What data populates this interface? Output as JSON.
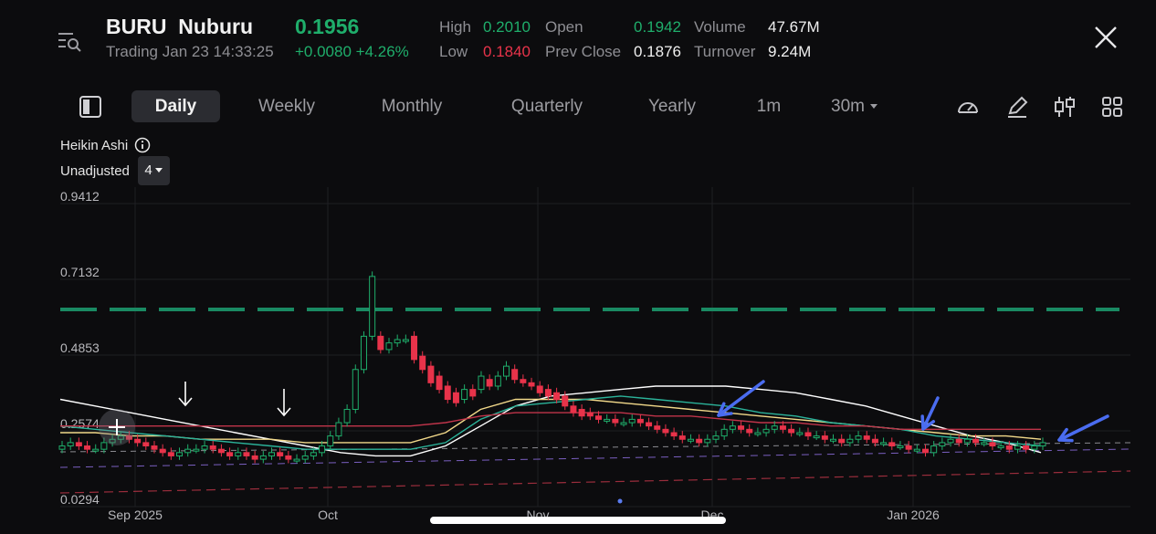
{
  "header": {
    "symbol": "BURU",
    "name": "Nuburu",
    "last_price": "0.1956",
    "trading_time": "Trading Jan 23 14:33:25",
    "change": "+0.0080 +4.26%",
    "stats": {
      "high_label": "High",
      "high": "0.2010",
      "low_label": "Low",
      "low": "0.1840",
      "open_label": "Open",
      "open": "0.1942",
      "prev_close_label": "Prev Close",
      "prev_close": "0.1876",
      "volume_label": "Volume",
      "volume": "47.67M",
      "turnover_label": "Turnover",
      "turnover": "9.24M"
    }
  },
  "tabs": {
    "daily": "Daily",
    "weekly": "Weekly",
    "monthly": "Monthly",
    "quarterly": "Quarterly",
    "yearly": "Yearly",
    "m1": "1m",
    "m30": "30m"
  },
  "chart_options": {
    "type_label": "Heikin Ashi",
    "adjust_label": "Unadjusted",
    "indicator_count": "4"
  },
  "icons": [
    "menu-search-icon",
    "close-icon",
    "panel-toggle-icon",
    "chevron-down-icon",
    "gauge-icon",
    "pencil-icon",
    "candlestick-icon",
    "grid-icon",
    "info-icon"
  ],
  "colors": {
    "up": "#1fae6b",
    "down": "#e8334a",
    "accent_line": "#1a8a63",
    "annotation_arrow": "#4a6cf0"
  },
  "chart_data": {
    "type": "candlestick",
    "y_ticks": [
      "0.9412",
      "0.7132",
      "0.4853",
      "0.2574",
      "0.0294"
    ],
    "x_ticks": [
      "Sep 2025",
      "Oct",
      "Nov",
      "Dec",
      "Jan 2026"
    ],
    "ylim": [
      0.0294,
      0.9412
    ],
    "reference_line": 0.62,
    "grid": true,
    "candles": [
      {
        "o": 0.18,
        "c": 0.19
      },
      {
        "o": 0.19,
        "c": 0.2
      },
      {
        "o": 0.2,
        "c": 0.19
      },
      {
        "o": 0.19,
        "c": 0.18
      },
      {
        "o": 0.18,
        "c": 0.18
      },
      {
        "o": 0.18,
        "c": 0.2
      },
      {
        "o": 0.2,
        "c": 0.21
      },
      {
        "o": 0.21,
        "c": 0.22
      },
      {
        "o": 0.22,
        "c": 0.21
      },
      {
        "o": 0.21,
        "c": 0.2
      },
      {
        "o": 0.2,
        "c": 0.19
      },
      {
        "o": 0.19,
        "c": 0.18
      },
      {
        "o": 0.18,
        "c": 0.17
      },
      {
        "o": 0.17,
        "c": 0.16
      },
      {
        "o": 0.16,
        "c": 0.17
      },
      {
        "o": 0.17,
        "c": 0.18
      },
      {
        "o": 0.18,
        "c": 0.18
      },
      {
        "o": 0.18,
        "c": 0.19
      },
      {
        "o": 0.19,
        "c": 0.18
      },
      {
        "o": 0.18,
        "c": 0.17
      },
      {
        "o": 0.17,
        "c": 0.16
      },
      {
        "o": 0.16,
        "c": 0.17
      },
      {
        "o": 0.17,
        "c": 0.16
      },
      {
        "o": 0.16,
        "c": 0.15
      },
      {
        "o": 0.15,
        "c": 0.16
      },
      {
        "o": 0.16,
        "c": 0.17
      },
      {
        "o": 0.17,
        "c": 0.16
      },
      {
        "o": 0.16,
        "c": 0.15
      },
      {
        "o": 0.15,
        "c": 0.15
      },
      {
        "o": 0.15,
        "c": 0.16
      },
      {
        "o": 0.16,
        "c": 0.17
      },
      {
        "o": 0.17,
        "c": 0.19
      },
      {
        "o": 0.19,
        "c": 0.22
      },
      {
        "o": 0.22,
        "c": 0.26
      },
      {
        "o": 0.26,
        "c": 0.3
      },
      {
        "o": 0.3,
        "c": 0.42
      },
      {
        "o": 0.42,
        "c": 0.52
      },
      {
        "o": 0.52,
        "c": 0.7
      },
      {
        "o": 0.52,
        "c": 0.48
      },
      {
        "o": 0.48,
        "c": 0.5
      },
      {
        "o": 0.5,
        "c": 0.51
      },
      {
        "o": 0.51,
        "c": 0.51
      },
      {
        "o": 0.52,
        "c": 0.45
      },
      {
        "o": 0.46,
        "c": 0.42
      },
      {
        "o": 0.43,
        "c": 0.38
      },
      {
        "o": 0.4,
        "c": 0.36
      },
      {
        "o": 0.37,
        "c": 0.33
      },
      {
        "o": 0.35,
        "c": 0.32
      },
      {
        "o": 0.33,
        "c": 0.36
      },
      {
        "o": 0.36,
        "c": 0.34
      },
      {
        "o": 0.36,
        "c": 0.4
      },
      {
        "o": 0.39,
        "c": 0.37
      },
      {
        "o": 0.37,
        "c": 0.4
      },
      {
        "o": 0.4,
        "c": 0.43
      },
      {
        "o": 0.42,
        "c": 0.39
      },
      {
        "o": 0.39,
        "c": 0.38
      },
      {
        "o": 0.38,
        "c": 0.37
      },
      {
        "o": 0.37,
        "c": 0.35
      },
      {
        "o": 0.36,
        "c": 0.34
      },
      {
        "o": 0.35,
        "c": 0.33
      },
      {
        "o": 0.34,
        "c": 0.31
      },
      {
        "o": 0.31,
        "c": 0.29
      },
      {
        "o": 0.3,
        "c": 0.28
      },
      {
        "o": 0.29,
        "c": 0.28
      },
      {
        "o": 0.28,
        "c": 0.27
      },
      {
        "o": 0.27,
        "c": 0.27
      },
      {
        "o": 0.27,
        "c": 0.26
      },
      {
        "o": 0.26,
        "c": 0.26
      },
      {
        "o": 0.26,
        "c": 0.27
      },
      {
        "o": 0.27,
        "c": 0.26
      },
      {
        "o": 0.26,
        "c": 0.25
      },
      {
        "o": 0.25,
        "c": 0.24
      },
      {
        "o": 0.24,
        "c": 0.23
      },
      {
        "o": 0.23,
        "c": 0.22
      },
      {
        "o": 0.22,
        "c": 0.21
      },
      {
        "o": 0.21,
        "c": 0.21
      },
      {
        "o": 0.21,
        "c": 0.2
      },
      {
        "o": 0.2,
        "c": 0.21
      },
      {
        "o": 0.21,
        "c": 0.22
      },
      {
        "o": 0.22,
        "c": 0.24
      },
      {
        "o": 0.24,
        "c": 0.25
      },
      {
        "o": 0.25,
        "c": 0.24
      },
      {
        "o": 0.24,
        "c": 0.23
      },
      {
        "o": 0.23,
        "c": 0.23
      },
      {
        "o": 0.23,
        "c": 0.24
      },
      {
        "o": 0.24,
        "c": 0.25
      },
      {
        "o": 0.25,
        "c": 0.24
      },
      {
        "o": 0.24,
        "c": 0.23
      },
      {
        "o": 0.23,
        "c": 0.23
      },
      {
        "o": 0.23,
        "c": 0.22
      },
      {
        "o": 0.22,
        "c": 0.22
      },
      {
        "o": 0.22,
        "c": 0.21
      },
      {
        "o": 0.21,
        "c": 0.21
      },
      {
        "o": 0.21,
        "c": 0.2
      },
      {
        "o": 0.2,
        "c": 0.21
      },
      {
        "o": 0.21,
        "c": 0.22
      },
      {
        "o": 0.22,
        "c": 0.21
      },
      {
        "o": 0.21,
        "c": 0.2
      },
      {
        "o": 0.2,
        "c": 0.2
      },
      {
        "o": 0.2,
        "c": 0.19
      },
      {
        "o": 0.19,
        "c": 0.19
      },
      {
        "o": 0.19,
        "c": 0.18
      },
      {
        "o": 0.18,
        "c": 0.18
      },
      {
        "o": 0.18,
        "c": 0.17
      },
      {
        "o": 0.17,
        "c": 0.19
      },
      {
        "o": 0.19,
        "c": 0.2
      },
      {
        "o": 0.2,
        "c": 0.21
      },
      {
        "o": 0.21,
        "c": 0.2
      },
      {
        "o": 0.2,
        "c": 0.21
      },
      {
        "o": 0.21,
        "c": 0.2
      },
      {
        "o": 0.2,
        "c": 0.2
      },
      {
        "o": 0.2,
        "c": 0.19
      },
      {
        "o": 0.19,
        "c": 0.19
      },
      {
        "o": 0.19,
        "c": 0.18
      },
      {
        "o": 0.18,
        "c": 0.19
      },
      {
        "o": 0.19,
        "c": 0.18
      },
      {
        "o": 0.18,
        "c": 0.19
      },
      {
        "o": 0.19,
        "c": 0.2
      }
    ],
    "moving_averages": [
      {
        "name": "",
        "color": "#ffffff",
        "values": [
          0.33,
          0.31,
          0.29,
          0.27,
          0.25,
          0.23,
          0.21,
          0.19,
          0.17,
          0.16,
          0.16,
          0.19,
          0.25,
          0.31,
          0.34,
          0.35,
          0.36,
          0.37,
          0.37,
          0.37,
          0.36,
          0.35,
          0.33,
          0.31,
          0.28,
          0.25,
          0.22,
          0.2,
          0.17
        ]
      },
      {
        "name": "",
        "color": "#f2d98a",
        "values": [
          0.23,
          0.23,
          0.22,
          0.22,
          0.21,
          0.21,
          0.21,
          0.2,
          0.2,
          0.2,
          0.2,
          0.23,
          0.3,
          0.33,
          0.33,
          0.33,
          0.32,
          0.31,
          0.3,
          0.29,
          0.28,
          0.27,
          0.26,
          0.25,
          0.24,
          0.23,
          0.22,
          0.22,
          0.21
        ]
      },
      {
        "name": "",
        "color": "#2bb39a",
        "values": [
          0.25,
          0.24,
          0.23,
          0.22,
          0.21,
          0.2,
          0.19,
          0.18,
          0.18,
          0.18,
          0.18,
          0.2,
          0.27,
          0.31,
          0.32,
          0.33,
          0.34,
          0.33,
          0.32,
          0.31,
          0.29,
          0.28,
          0.26,
          0.25,
          0.24,
          0.22,
          0.21,
          0.2,
          0.19
        ]
      },
      {
        "name": "",
        "color": "#c0344a",
        "values": [
          0.25,
          0.25,
          0.25,
          0.25,
          0.25,
          0.25,
          0.25,
          0.25,
          0.25,
          0.25,
          0.25,
          0.26,
          0.28,
          0.29,
          0.29,
          0.29,
          0.29,
          0.28,
          0.28,
          0.27,
          0.26,
          0.26,
          0.25,
          0.25,
          0.24,
          0.24,
          0.24,
          0.24,
          0.24
        ]
      }
    ]
  }
}
